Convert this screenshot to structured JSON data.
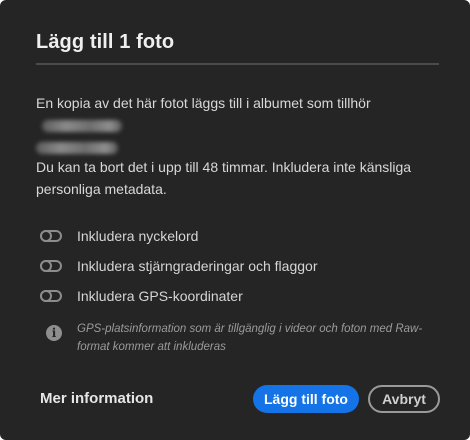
{
  "dialog": {
    "title": "Lägg till 1 foto",
    "paragraph1": "En kopia av det här fotot läggs till i albumet som tillhör",
    "paragraph2": "Du kan ta bort det i upp till 48 timmar. Inkludera inte känsliga personliga metadata.",
    "options": [
      {
        "label": "Inkludera nyckelord",
        "enabled": false
      },
      {
        "label": "Inkludera stjärngraderingar och flaggor",
        "enabled": false
      },
      {
        "label": "Inkludera GPS-koordinater",
        "enabled": false
      }
    ],
    "gps_note": "GPS-platsinformation som är tillgänglig i videor och foton med Raw-format kommer att inkluderas",
    "info_icon": "info-icon",
    "more_info_label": "Mer information",
    "primary_button": "Lägg till foto",
    "cancel_button": "Avbryt"
  },
  "colors": {
    "background": "#252525",
    "accent": "#1473e6",
    "text": "#dedede",
    "muted": "#9b9b9b"
  }
}
